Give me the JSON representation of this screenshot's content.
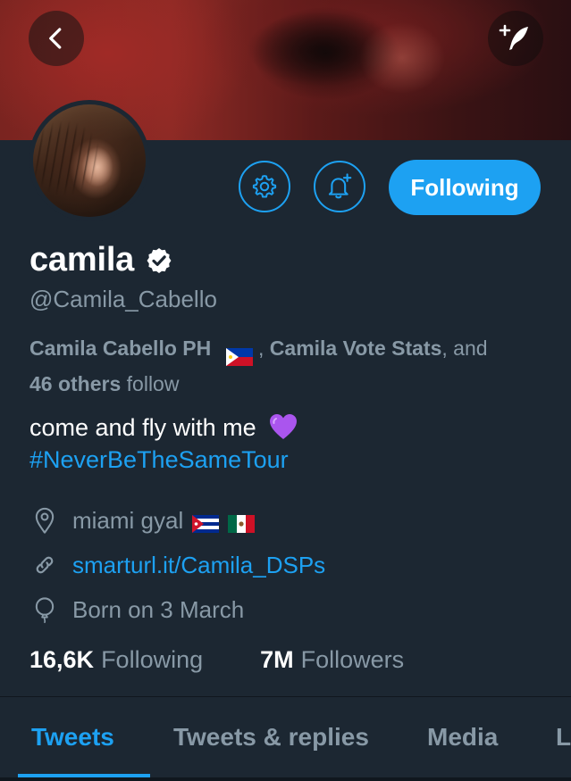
{
  "profile": {
    "display_name": "camila",
    "handle": "@Camila_Cabello",
    "followed_by": {
      "name1": "Camila Cabello PH",
      "separator": " , ",
      "name2": "Camila Vote Stats",
      "and_text": ", and",
      "others": "46 others",
      "follow_text": " follow"
    },
    "bio": "come and fly with me",
    "bio_emoji": "purple-heart",
    "hashtag": "#NeverBeTheSameTour",
    "location": "miami gyal",
    "website": "smarturl.it/Camila_DSPs",
    "birth": "Born on 3 March",
    "following_count": "16,6K",
    "following_label": "Following",
    "followers_count": "7M",
    "followers_label": "Followers"
  },
  "actions": {
    "follow_state_label": "Following"
  },
  "tabs": [
    {
      "label": "Tweets",
      "active": true
    },
    {
      "label": "Tweets & replies",
      "active": false
    },
    {
      "label": "Media",
      "active": false
    },
    {
      "label": "L",
      "active": false
    }
  ],
  "icons": {
    "back": "chevron-left-icon",
    "compose": "compose-quill-icon",
    "settings": "gear-icon",
    "notify": "bell-plus-icon",
    "verified": "verified-badge-icon",
    "location": "location-pin-icon",
    "link": "link-icon",
    "birth": "balloon-icon"
  },
  "colors": {
    "accent": "#1da1f2",
    "background": "#1c2732",
    "secondary_text": "#8899a6"
  }
}
